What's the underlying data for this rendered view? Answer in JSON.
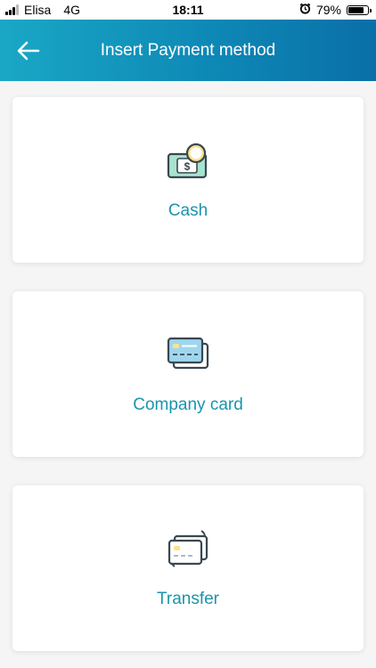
{
  "status_bar": {
    "carrier": "Elisa",
    "network": "4G",
    "time": "18:11",
    "battery": "79%",
    "battery_level": 0.79,
    "icons": [
      "signal-icon",
      "alarm-icon",
      "battery-icon"
    ]
  },
  "header": {
    "title": "Insert Payment method",
    "back_icon": "arrow-left-icon"
  },
  "payment_methods": [
    {
      "label": "Cash",
      "icon": "cash-icon"
    },
    {
      "label": "Company card",
      "icon": "cards-icon"
    },
    {
      "label": "Transfer",
      "icon": "transfer-icon"
    }
  ],
  "colors": {
    "header_start": "#1aa7c5",
    "header_end": "#0a6fa7",
    "accent_text": "#1a94ad",
    "icon_outline": "#3a4750",
    "cash_green": "#a8e3cf",
    "coin_yellow": "#fbe28e",
    "card_blue": "#9fd6ee",
    "card_chip": "#fbe28e"
  }
}
